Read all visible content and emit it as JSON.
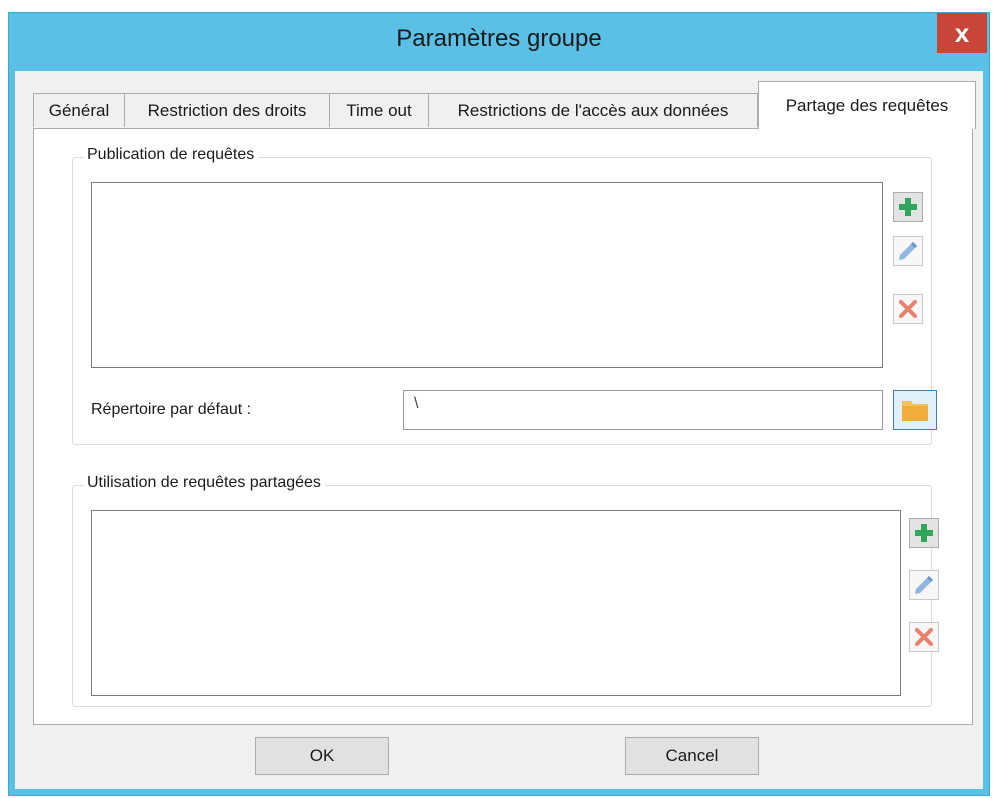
{
  "window": {
    "title": "Paramètres groupe",
    "close_glyph": "x",
    "accent_color": "#5bc0e6",
    "close_color": "#c9453a"
  },
  "tabs": [
    {
      "label": "Général",
      "active": false
    },
    {
      "label": "Restriction des droits",
      "active": false
    },
    {
      "label": "Time out",
      "active": false
    },
    {
      "label": "Restrictions de l'accès aux données",
      "active": false
    },
    {
      "label": "Partage des requêtes",
      "active": true
    }
  ],
  "publication": {
    "legend": "Publication de requêtes",
    "items": [],
    "default_dir_label": "Répertoire par défaut :",
    "default_dir_value": "\\",
    "buttons": {
      "add": "plus-icon",
      "edit": "pencil-icon",
      "delete": "cross-icon",
      "browse": "folder-icon"
    }
  },
  "shared_usage": {
    "legend": "Utilisation de requêtes partagées",
    "items": [],
    "buttons": {
      "add": "plus-icon",
      "edit": "pencil-icon",
      "delete": "cross-icon"
    }
  },
  "footer": {
    "ok_label": "OK",
    "cancel_label": "Cancel"
  }
}
